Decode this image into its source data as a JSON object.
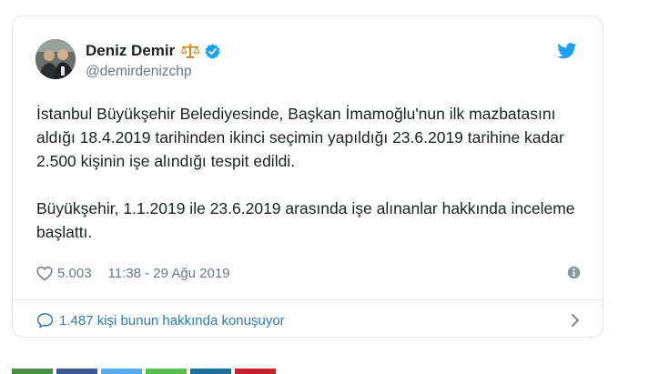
{
  "tweet": {
    "author_name": "Deniz Demir",
    "author_handle": "@demirdenizchp",
    "paragraphs": [
      "İstanbul Büyükşehir Belediyesinde, Başkan İmamoğlu'nun ilk mazbatasını aldığı 18.4.2019 tarihinden ikinci seçimin yapıldığı 23.6.2019 tarihine kadar 2.500 kişinin işe alındığı tespit edildi.",
      "Büyükşehir, 1.1.2019 ile 23.6.2019 arasında işe alınanlar hakkında inceleme başlattı."
    ],
    "like_count": "5.003",
    "timestamp": "11:38 - 29 Ağu 2019",
    "conversation_text": "1.487 kişi bunun hakkında konuşuyor"
  },
  "icons": {
    "brand": "twitter-bird-icon",
    "verified": "verified-badge-icon",
    "scales": "scales-emoji-icon",
    "like": "heart-icon",
    "info": "info-icon",
    "conversation": "speech-bubble-icon",
    "chevron": "chevron-right-icon"
  },
  "colors": {
    "twitter_blue": "#1da1f2",
    "link_blue": "#2b7bb9",
    "muted_gray": "#697882",
    "text": "#1c2022",
    "border": "#e1e8ed"
  },
  "share_bar_colors": [
    "#4a8f46",
    "#3b5998",
    "#55acee",
    "#57c14c",
    "#1b6f9e",
    "#c8232c"
  ]
}
